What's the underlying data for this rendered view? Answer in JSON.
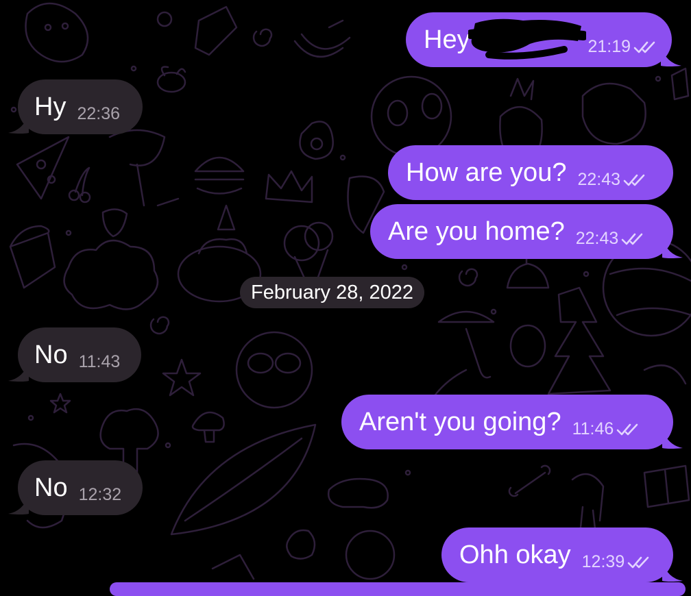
{
  "chat": {
    "date_divider": "February 28, 2022",
    "messages": [
      {
        "text": "Hey",
        "time": "21:19",
        "direction": "outgoing",
        "status": "read",
        "partially_redacted": true
      },
      {
        "text": "Hy",
        "time": "22:36",
        "direction": "incoming"
      },
      {
        "text": "How are you?",
        "time": "22:43",
        "direction": "outgoing",
        "status": "read"
      },
      {
        "text": "Are you home?",
        "time": "22:43",
        "direction": "outgoing",
        "status": "read"
      },
      {
        "text": "No",
        "time": "11:43",
        "direction": "incoming"
      },
      {
        "text": "Aren't you going?",
        "time": "11:46",
        "direction": "outgoing",
        "status": "read"
      },
      {
        "text": "No",
        "time": "12:32",
        "direction": "incoming"
      },
      {
        "text": "Ohh okay",
        "time": "12:39",
        "direction": "outgoing",
        "status": "read"
      }
    ]
  },
  "theme": {
    "background": "#000000",
    "outgoing_bubble": "#8c4ff0",
    "incoming_bubble": "#2b252c",
    "wallpaper_doodle": "#2e1f3a",
    "outgoing_time": "#e3d4ff",
    "incoming_time": "#a9a2ab"
  },
  "icons": {
    "read_status": "double-check-icon",
    "wallpaper": "doodle-pattern"
  }
}
